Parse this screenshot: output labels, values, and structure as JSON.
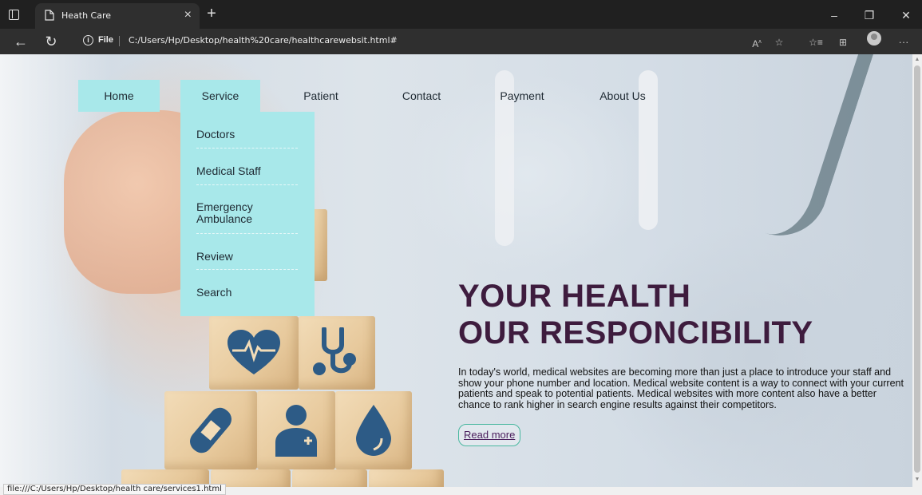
{
  "browser": {
    "tab_title": "Heath Care",
    "tab_close": "×",
    "new_tab": "+",
    "url_scheme_label": "File",
    "url": "C:/Users/Hp/Desktop/health%20care/healthcarewebsit.html#",
    "status_url": "file:///C:/Users/Hp/Desktop/health care/services1.html",
    "window_minimize": "–",
    "window_restore": "❐",
    "window_close": "✕",
    "more": "···"
  },
  "nav": {
    "items": [
      {
        "label": "Home"
      },
      {
        "label": "Service"
      },
      {
        "label": "Patient"
      },
      {
        "label": "Contact"
      },
      {
        "label": "Payment"
      },
      {
        "label": "About Us"
      }
    ]
  },
  "service_menu": {
    "items": [
      {
        "label": "Doctors"
      },
      {
        "label": "Medical Staff"
      },
      {
        "label": "Emergency Ambulance"
      },
      {
        "label": "Review"
      },
      {
        "label": "Search"
      }
    ]
  },
  "hero": {
    "title_line1": "YOUR HEALTH",
    "title_line2": "OUR RESPONCIBILITY",
    "description": "In today's world, medical websites are becoming more than just a place to introduce your staff and show your phone number and location. Medical website content is a way to connect with your current patients and speak to potential patients. Medical websites with more content also have a better chance to rank higher in search engine results against their competitors.",
    "cta": "Read more"
  },
  "colors": {
    "nav_active_bg": "#a8e8ea",
    "hero_title": "#3e1c3e",
    "icon_blue": "#2d5b86"
  }
}
